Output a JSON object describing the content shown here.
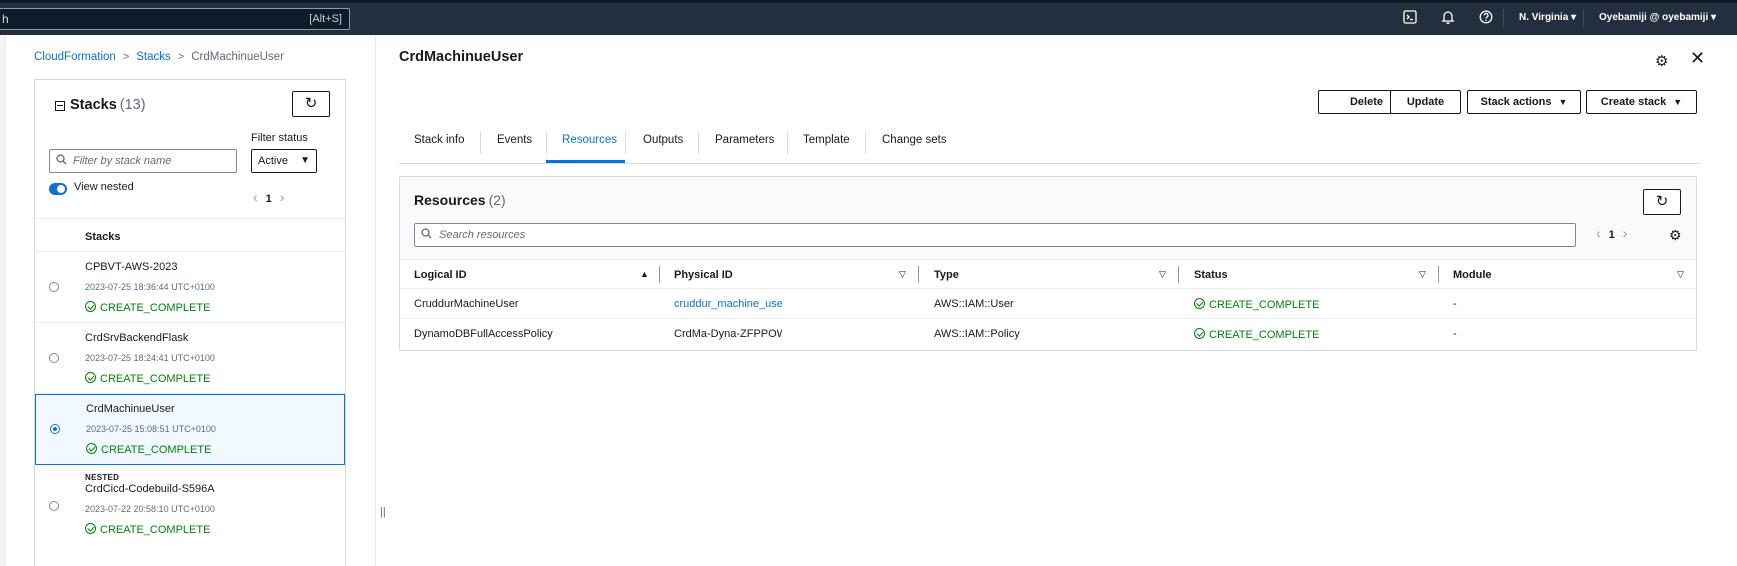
{
  "topnav": {
    "search_value": "h",
    "search_shortcut": "[Alt+S]",
    "icons": [
      "cloudshell-icon",
      "bell-icon",
      "help-icon"
    ],
    "region": "N. Virginia",
    "account": "Oyebamiji @ oyebamiji"
  },
  "breadcrumb": {
    "items": [
      "CloudFormation",
      "Stacks",
      "CrdMachinueUser"
    ]
  },
  "stacks": {
    "title": "Stacks",
    "count": "(13)",
    "filter_label": "Filter status",
    "filter_placeholder": "Filter by stack name",
    "status_value": "Active",
    "view_nested_label": "View nested",
    "page": "1",
    "column_header": "Stacks",
    "rows": [
      {
        "nested": "",
        "name": "CPBVT-AWS-2023",
        "date": "2023-07-25 18:36:44 UTC+0100",
        "status": "CREATE_COMPLETE",
        "selected": false
      },
      {
        "nested": "",
        "name": "CrdSrvBackendFlask",
        "date": "2023-07-25 18:24:41 UTC+0100",
        "status": "CREATE_COMPLETE",
        "selected": false
      },
      {
        "nested": "",
        "name": "CrdMachinueUser",
        "date": "2023-07-25 15:08:51 UTC+0100",
        "status": "CREATE_COMPLETE",
        "selected": true
      },
      {
        "nested": "NESTED",
        "name": "CrdCicd-Codebuild-S596A",
        "date": "2023-07-22 20:58:10 UTC+0100",
        "status": "CREATE_COMPLETE",
        "selected": false
      }
    ]
  },
  "detail": {
    "title": "CrdMachinueUser",
    "buttons": {
      "delete": "Delete",
      "update": "Update",
      "stack_actions": "Stack actions",
      "create_stack": "Create stack"
    },
    "tabs": [
      "Stack info",
      "Events",
      "Resources",
      "Outputs",
      "Parameters",
      "Template",
      "Change sets"
    ],
    "active_tab": "Resources"
  },
  "resources": {
    "title": "Resources",
    "count": "(2)",
    "search_placeholder": "Search resources",
    "page": "1",
    "columns": [
      "Logical ID",
      "Physical ID",
      "Type",
      "Status",
      "Module"
    ],
    "rows": [
      {
        "logical_id": "CruddurMachineUser",
        "physical_id": "cruddur_machine_user",
        "type": "AWS::IAM::User",
        "status": "CREATE_COMPLETE",
        "module": "-"
      },
      {
        "logical_id": "DynamoDBFullAccessPolicy",
        "physical_id": "CrdMa-Dyna-ZFPPOWL",
        "type": "AWS::IAM::Policy",
        "status": "CREATE_COMPLETE",
        "module": "-"
      }
    ]
  },
  "colors": {
    "nav_bg": "#232f3e",
    "link": "#0972d3",
    "success": "#037f0c",
    "selected_bg": "#f1f8ff"
  }
}
